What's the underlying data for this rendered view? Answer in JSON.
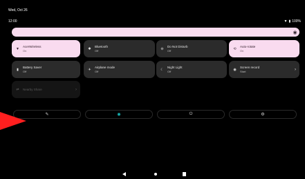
{
  "status_bar": {
    "date": "Wed, Oct 26",
    "time": "12:00",
    "battery": "100%"
  },
  "tiles": [
    {
      "label": "AcerWireless",
      "sub": "On",
      "icon": "wifi-icon",
      "state": "on"
    },
    {
      "label": "Bluetooth",
      "sub": "Off",
      "icon": "bluetooth-icon",
      "state": "off"
    },
    {
      "label": "Do Not Disturb",
      "sub": "Off",
      "icon": "dnd-icon",
      "state": "off"
    },
    {
      "label": "Auto-rotate",
      "sub": "On",
      "icon": "rotate-icon",
      "state": "on"
    },
    {
      "label": "Battery Saver",
      "sub": "Off",
      "icon": "battery-icon",
      "state": "off"
    },
    {
      "label": "Airplane mode",
      "sub": "Off",
      "icon": "airplane-icon",
      "state": "off"
    },
    {
      "label": "Night Light",
      "sub": "Off",
      "icon": "moon-icon",
      "state": "off"
    },
    {
      "label": "Screen record",
      "sub": "Start",
      "icon": "record-icon",
      "state": "off"
    },
    {
      "label": "Nearby Share",
      "sub": "",
      "icon": "nearby-share-icon",
      "state": "disabled"
    }
  ],
  "footer_buttons": [
    {
      "name": "edit-icon",
      "glyph": "✎"
    },
    {
      "name": "user-icon",
      "glyph": "◉"
    },
    {
      "name": "power-icon",
      "glyph": "⏻"
    },
    {
      "name": "settings-icon",
      "glyph": "⚙"
    }
  ],
  "colors": {
    "tile_on": "#f9dbef",
    "tile_off": "#2b2b2b",
    "accent": "#19c4c4",
    "pointer": "#ff1f1f"
  }
}
